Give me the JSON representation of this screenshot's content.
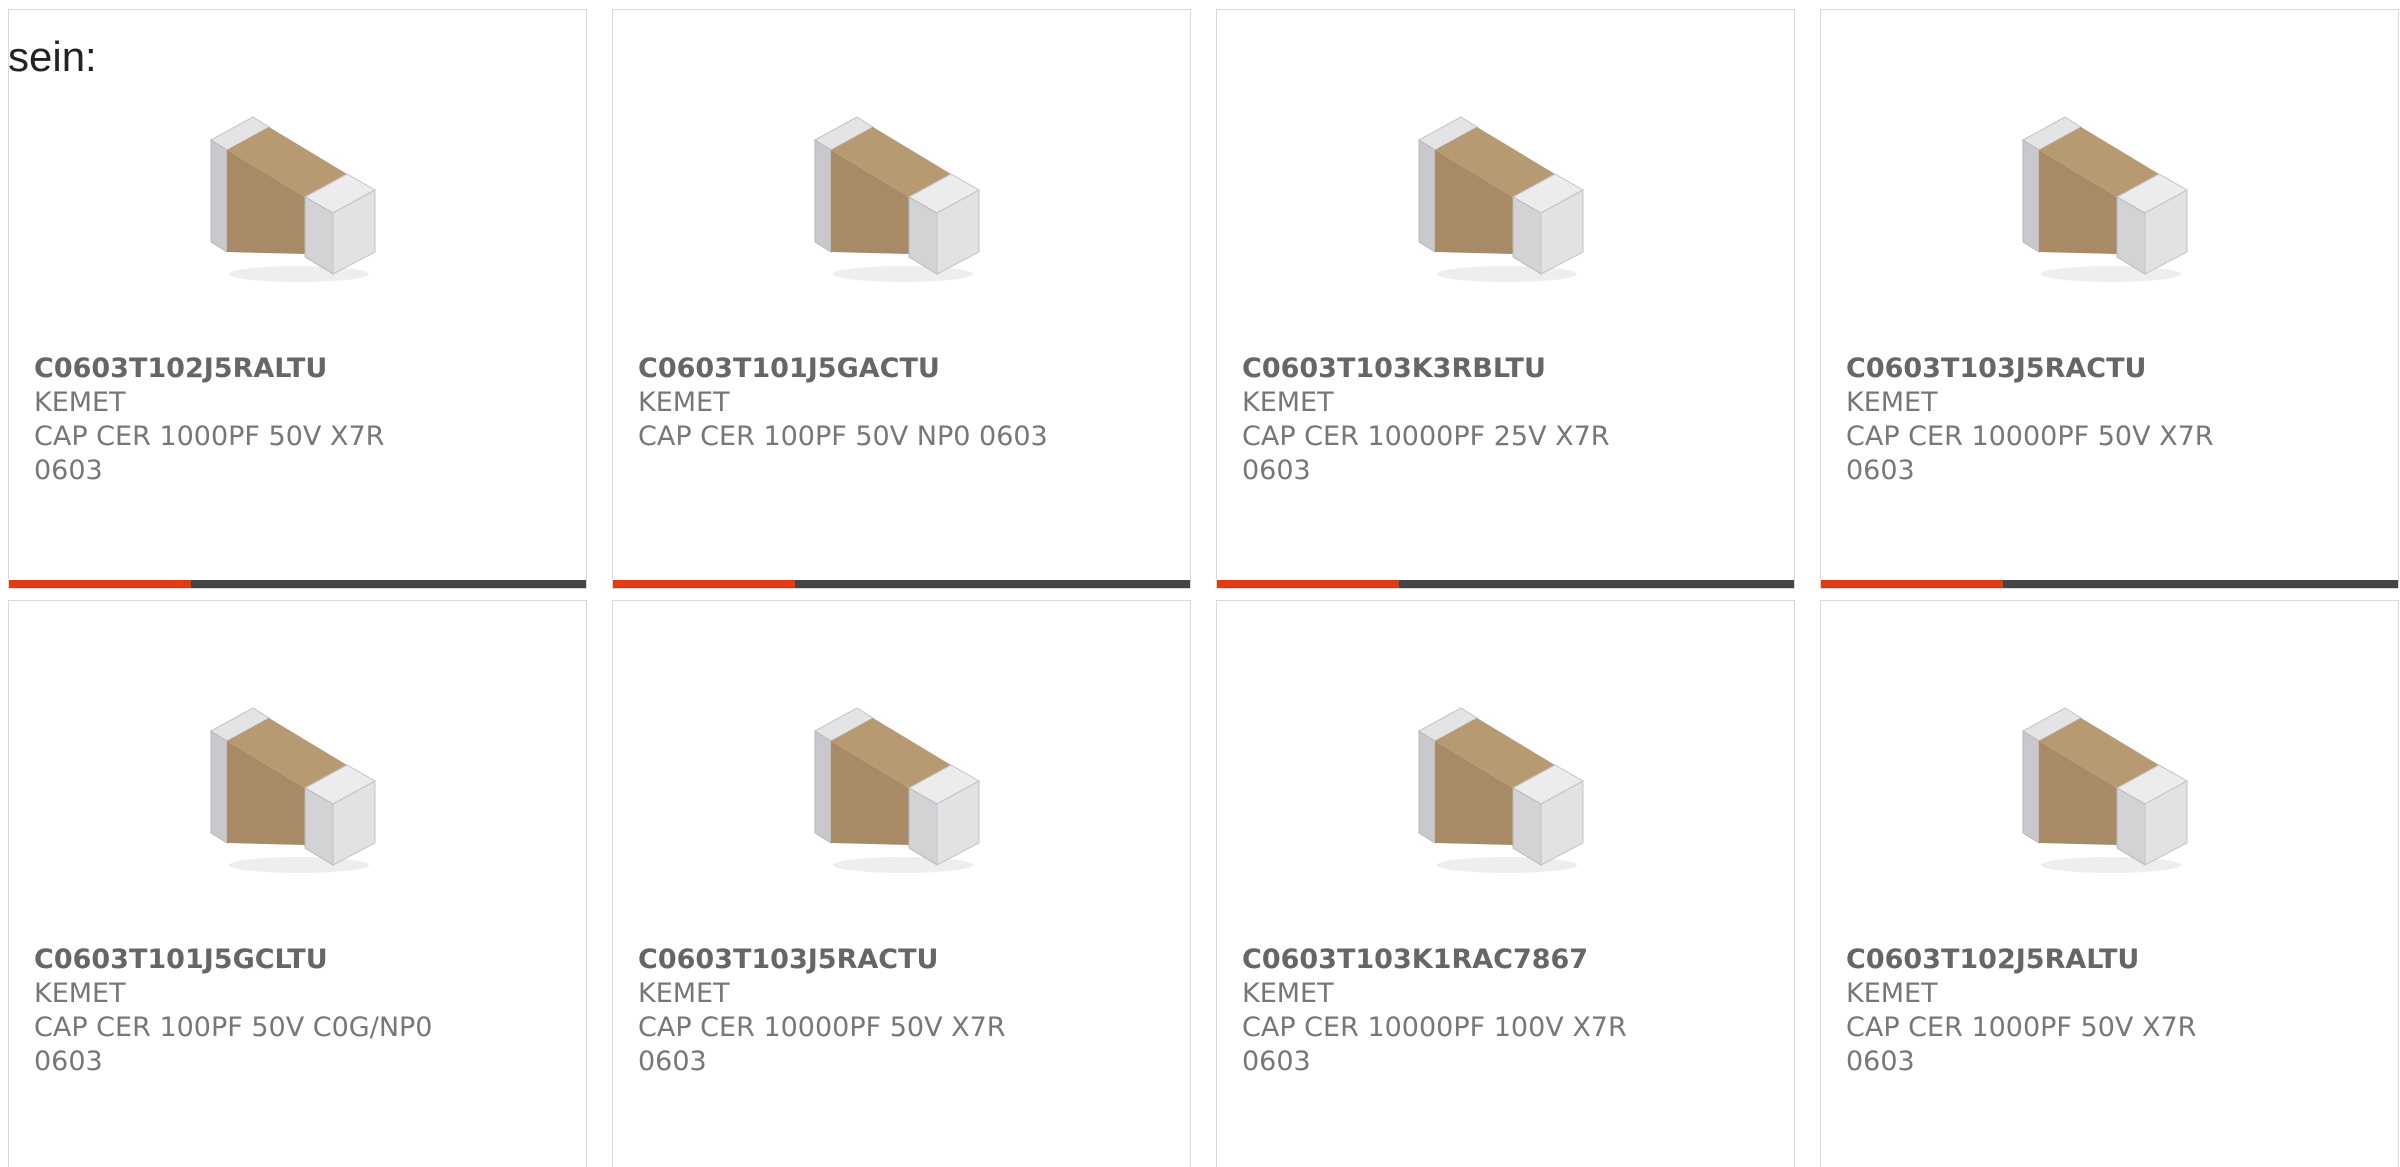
{
  "intro_text": "sein:",
  "colors": {
    "accent": "#e13b13",
    "footer_bar": "#444444",
    "card_border": "#d9d9d9",
    "text": "#777777",
    "cap_body": "#a98a66",
    "cap_terminal": "#d3d3d6"
  },
  "icons": {
    "product_image": "smd-capacitor-0603"
  },
  "products": [
    {
      "part": "C0603T102J5RALTU",
      "manufacturer": "KEMET",
      "description": "CAP CER 1000PF 50V X7R 0603"
    },
    {
      "part": "C0603T101J5GACTU",
      "manufacturer": "KEMET",
      "description": "CAP CER 100PF 50V NP0 0603"
    },
    {
      "part": "C0603T103K3RBLTU",
      "manufacturer": "KEMET",
      "description": "CAP CER 10000PF 25V X7R 0603"
    },
    {
      "part": "C0603T103J5RACTU",
      "manufacturer": "KEMET",
      "description": "CAP CER 10000PF 50V X7R 0603"
    },
    {
      "part": "C0603T101J5GCLTU",
      "manufacturer": "KEMET",
      "description": "CAP CER 100PF 50V C0G/NP0 0603"
    },
    {
      "part": "C0603T103J5RACTU",
      "manufacturer": "KEMET",
      "description": "CAP CER 10000PF 50V X7R 0603"
    },
    {
      "part": "C0603T103K1RAC7867",
      "manufacturer": "KEMET",
      "description": "CAP CER 10000PF 100V X7R 0603"
    },
    {
      "part": "C0603T102J5RALTU",
      "manufacturer": "KEMET",
      "description": "CAP CER 1000PF 50V X7R 0603"
    }
  ]
}
